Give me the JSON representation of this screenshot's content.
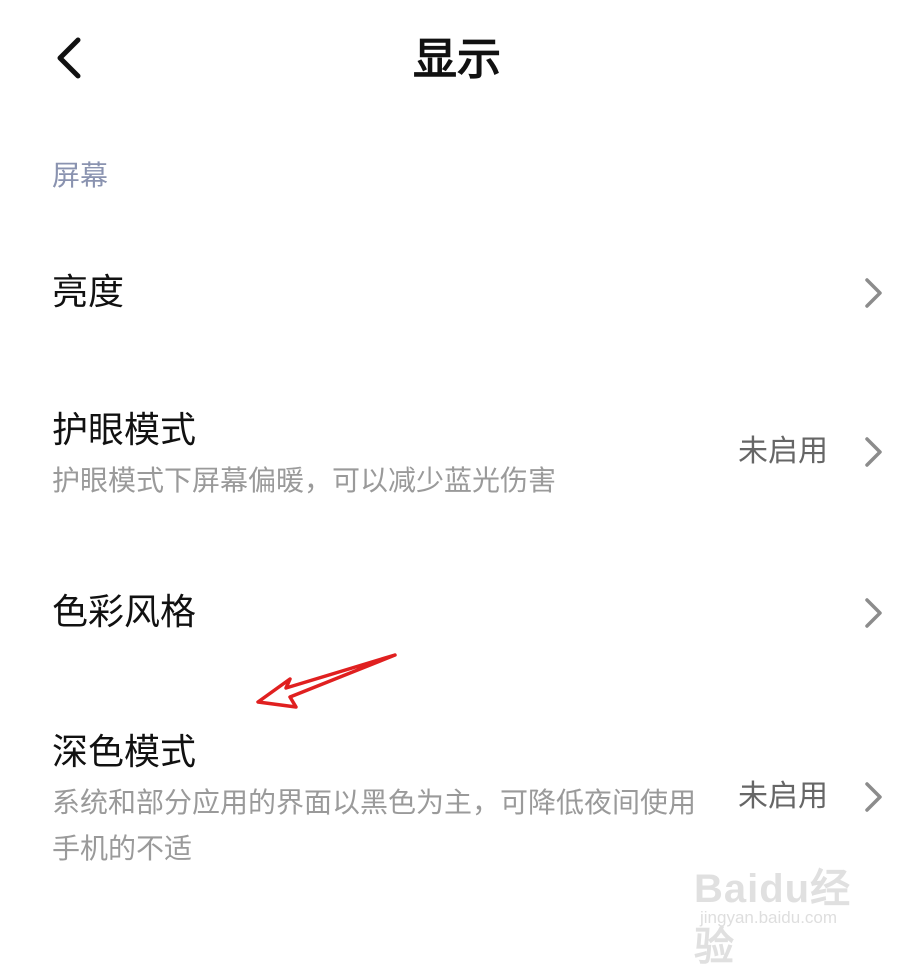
{
  "header": {
    "title": "显示",
    "back_icon": "chevron-left-icon"
  },
  "section": {
    "title": "屏幕"
  },
  "items": [
    {
      "title": "亮度",
      "description": "",
      "value": ""
    },
    {
      "title": "护眼模式",
      "description": "护眼模式下屏幕偏暖，可以减少蓝光伤害",
      "value": "未启用"
    },
    {
      "title": "色彩风格",
      "description": "",
      "value": ""
    },
    {
      "title": "深色模式",
      "description": "系统和部分应用的界面以黑色为主，可降低夜间使用手机的不适",
      "value": "未启用"
    }
  ],
  "annotation": {
    "color": "#e02020"
  },
  "watermark": {
    "logo": "Baidu经验",
    "url": "jingyan.baidu.com"
  },
  "colors": {
    "section_title": "#8a93b0",
    "description": "#9a9a9a",
    "value": "#666666",
    "chevron": "#8c8c8c"
  }
}
